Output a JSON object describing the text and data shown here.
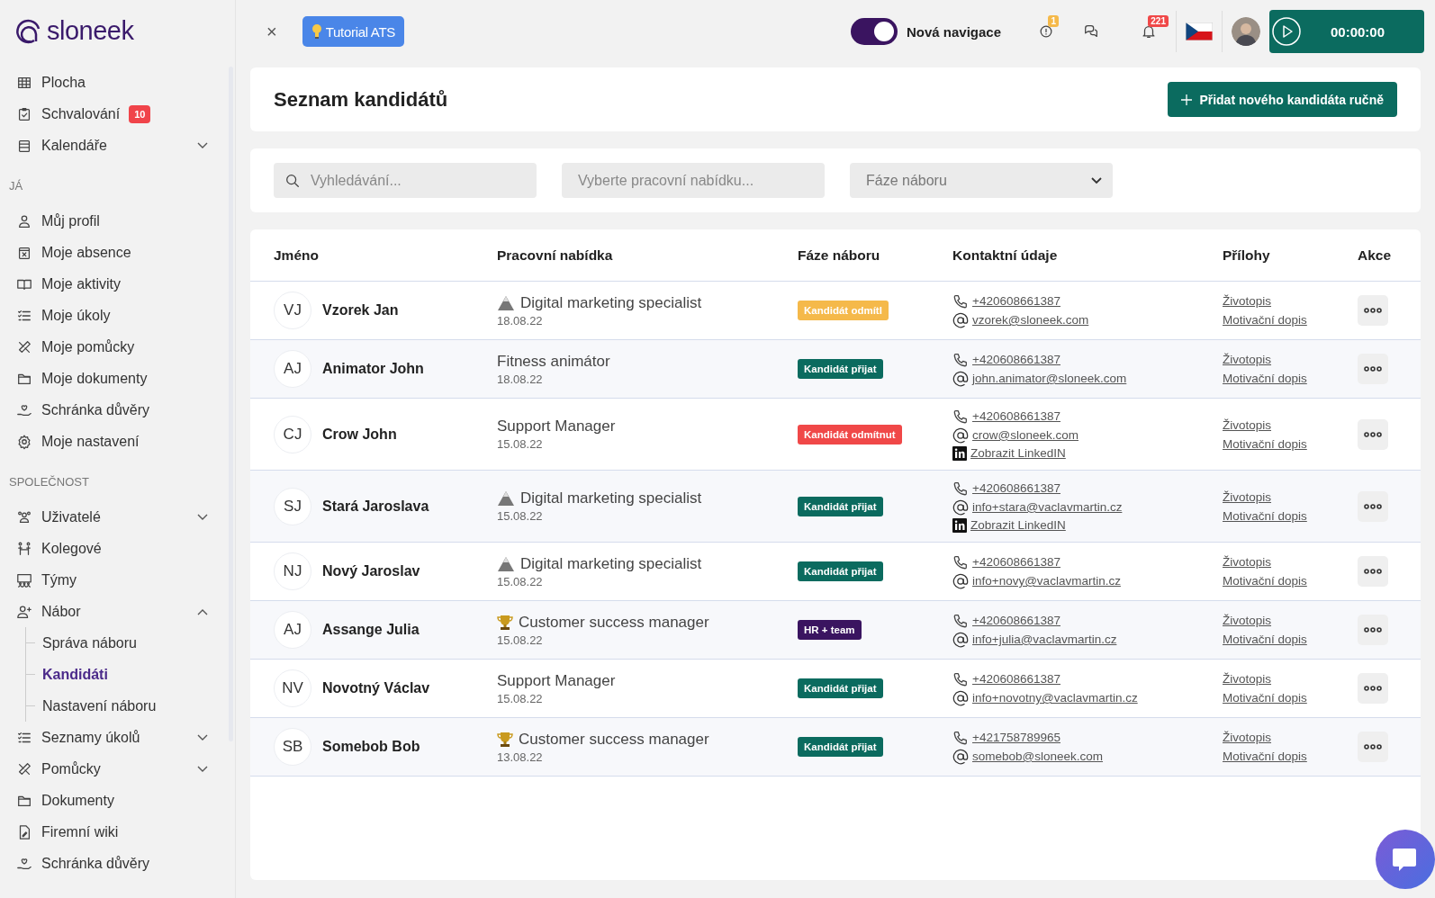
{
  "logo": "sloneek",
  "sidebar": {
    "sections": [
      {
        "items": [
          {
            "label": "Plocha",
            "selected": false
          },
          {
            "label": "Schvalování",
            "badge": "10",
            "selected": false
          },
          {
            "label": "Kalendáře",
            "expanded": false,
            "selected": false
          }
        ]
      },
      {
        "heading": "JÁ",
        "items": [
          {
            "label": "Můj profil",
            "selected": false
          },
          {
            "label": "Moje absence",
            "selected": false
          },
          {
            "label": "Moje aktivity",
            "selected": false
          },
          {
            "label": "Moje úkoly",
            "selected": false
          },
          {
            "label": "Moje pomůcky",
            "selected": false
          },
          {
            "label": "Moje dokumenty",
            "selected": false
          },
          {
            "label": "Schránka důvěry",
            "selected": false
          },
          {
            "label": "Moje nastavení",
            "selected": false
          }
        ]
      },
      {
        "heading": "SPOLEČNOST",
        "items": [
          {
            "label": "Uživatelé",
            "expanded": false,
            "selected": false
          },
          {
            "label": "Kolegové",
            "selected": false
          },
          {
            "label": "Týmy",
            "selected": false
          },
          {
            "label": "Nábor",
            "expanded": true,
            "selected": false,
            "children": [
              {
                "label": "Správa náboru",
                "selected": false
              },
              {
                "label": "Kandidáti",
                "selected": true
              },
              {
                "label": "Nastavení náboru",
                "selected": false
              }
            ]
          },
          {
            "label": "Seznamy úkolů",
            "expanded": false,
            "selected": false
          },
          {
            "label": "Pomůcky",
            "expanded": false,
            "selected": false
          },
          {
            "label": "Dokumenty",
            "selected": false
          },
          {
            "label": "Firemní wiki",
            "selected": false
          },
          {
            "label": "Schránka důvěry",
            "selected": false
          }
        ]
      }
    ]
  },
  "topbar": {
    "close": "×",
    "tutorial": "Tutorial ATS",
    "navigation_toggle": {
      "label": "Nová navigace",
      "on": true
    },
    "alerts_badge": "1",
    "notifications_badge": "221",
    "timer": "00:00:00"
  },
  "page": {
    "title": "Seznam kandidátů",
    "add_button": "Přidat nového kandidáta ručně"
  },
  "filters": {
    "search": {
      "placeholder": "Vyhledávání..."
    },
    "job": {
      "placeholder": "Vyberte pracovní nabídku..."
    },
    "phase": {
      "placeholder": "Fáze náboru"
    }
  },
  "table": {
    "columns": [
      "Jméno",
      "Pracovní nabídka",
      "Fáze náboru",
      "Kontaktní údaje",
      "Přílohy",
      "Akce"
    ],
    "rows": [
      {
        "initials": "VJ",
        "name": "Vzorek Jan",
        "job": {
          "kind": "hazard",
          "title": "Digital marketing specialist",
          "date": "18.08.22"
        },
        "stage": {
          "label": "Kandidát odmítl",
          "color": "#f5b94a"
        },
        "contacts": [
          {
            "kind": "phone",
            "text": "+420608661387"
          },
          {
            "kind": "email",
            "text": "vzorek@sloneek.com"
          }
        ],
        "attachments": [
          "Životopis",
          "Motivační dopis"
        ]
      },
      {
        "initials": "AJ",
        "name": "Animator John",
        "job": {
          "kind": "plain",
          "title": "Fitness animátor",
          "date": "18.08.22"
        },
        "stage": {
          "label": "Kandidát přijat",
          "color": "#0b6b5f"
        },
        "contacts": [
          {
            "kind": "phone",
            "text": "+420608661387"
          },
          {
            "kind": "email",
            "text": "john.animator@sloneek.com"
          }
        ],
        "attachments": [
          "Životopis",
          "Motivační dopis"
        ]
      },
      {
        "initials": "CJ",
        "name": "Crow John",
        "job": {
          "kind": "plain",
          "title": "Support Manager",
          "date": "15.08.22"
        },
        "stage": {
          "label": "Kandidát odmítnut",
          "color": "#f04848"
        },
        "contacts": [
          {
            "kind": "phone",
            "text": "+420608661387"
          },
          {
            "kind": "email",
            "text": "crow@sloneek.com"
          },
          {
            "kind": "linkedin",
            "text": "Zobrazit LinkedIN"
          }
        ],
        "attachments": [
          "Životopis",
          "Motivační dopis"
        ]
      },
      {
        "initials": "SJ",
        "name": "Stará Jaroslava",
        "job": {
          "kind": "hazard",
          "title": "Digital marketing specialist",
          "date": "15.08.22"
        },
        "stage": {
          "label": "Kandidát přijat",
          "color": "#0b6b5f"
        },
        "contacts": [
          {
            "kind": "phone",
            "text": "+420608661387"
          },
          {
            "kind": "email",
            "text": "info+stara@vaclavmartin.cz"
          },
          {
            "kind": "linkedin",
            "text": "Zobrazit LinkedIN"
          }
        ],
        "attachments": [
          "Životopis",
          "Motivační dopis"
        ]
      },
      {
        "initials": "NJ",
        "name": "Nový Jaroslav",
        "job": {
          "kind": "hazard",
          "title": "Digital marketing specialist",
          "date": "15.08.22"
        },
        "stage": {
          "label": "Kandidát přijat",
          "color": "#0b6b5f"
        },
        "contacts": [
          {
            "kind": "phone",
            "text": "+420608661387"
          },
          {
            "kind": "email",
            "text": "info+novy@vaclavmartin.cz"
          }
        ],
        "attachments": [
          "Životopis",
          "Motivační dopis"
        ]
      },
      {
        "initials": "AJ",
        "name": "Assange Julia",
        "job": {
          "kind": "trophy",
          "title": "Customer success manager",
          "date": "15.08.22"
        },
        "stage": {
          "label": "HR + team",
          "color": "#3a1460"
        },
        "contacts": [
          {
            "kind": "phone",
            "text": "+420608661387"
          },
          {
            "kind": "email",
            "text": "info+julia@vaclavmartin.cz"
          }
        ],
        "attachments": [
          "Životopis",
          "Motivační dopis"
        ]
      },
      {
        "initials": "NV",
        "name": "Novotný Václav",
        "job": {
          "kind": "plain",
          "title": "Support Manager",
          "date": "15.08.22"
        },
        "stage": {
          "label": "Kandidát přijat",
          "color": "#0b6b5f"
        },
        "contacts": [
          {
            "kind": "phone",
            "text": "+420608661387"
          },
          {
            "kind": "email",
            "text": "info+novotny@vaclavmartin.cz"
          }
        ],
        "attachments": [
          "Životopis",
          "Motivační dopis"
        ]
      },
      {
        "initials": "SB",
        "name": "Somebob Bob",
        "job": {
          "kind": "trophy",
          "title": "Customer success manager",
          "date": "13.08.22"
        },
        "stage": {
          "label": "Kandidát přijat",
          "color": "#0b6b5f"
        },
        "contacts": [
          {
            "kind": "phone",
            "text": "+421758789965"
          },
          {
            "kind": "email",
            "text": "somebob@sloneek.com"
          }
        ],
        "attachments": [
          "Životopis",
          "Motivační dopis"
        ]
      }
    ]
  }
}
